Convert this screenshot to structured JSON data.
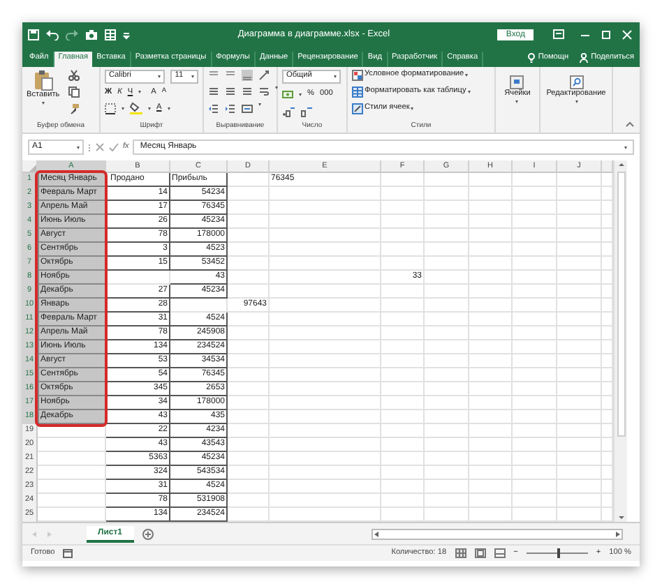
{
  "window": {
    "title": "Диаграмма в диаграмме.xlsx  -  Excel",
    "sign_in": "Вход"
  },
  "tabs": [
    {
      "label": "Файл",
      "selected": false
    },
    {
      "label": "Главная",
      "selected": true
    },
    {
      "label": "Вставка",
      "selected": false
    },
    {
      "label": "Разметка страницы",
      "selected": false
    },
    {
      "label": "Формулы",
      "selected": false
    },
    {
      "label": "Данные",
      "selected": false
    },
    {
      "label": "Рецензирование",
      "selected": false
    },
    {
      "label": "Вид",
      "selected": false
    },
    {
      "label": "Разработчик",
      "selected": false
    },
    {
      "label": "Справка",
      "selected": false
    }
  ],
  "tell_me": "Помощн",
  "share": "Поделиться",
  "ribbon": {
    "clipboard": {
      "paste": "Вставить",
      "label": "Буфер обмена"
    },
    "font": {
      "name": "Calibri",
      "size": "11",
      "bold": "Ж",
      "italic": "К",
      "underline": "Ч",
      "grow": "A",
      "shrink": "A",
      "font_color_button": "A",
      "label": "Шрифт"
    },
    "alignment": {
      "label": "Выравнивание"
    },
    "number": {
      "format": "Общий",
      "percent": "%",
      "thousands": "000",
      "label": "Число"
    },
    "styles": {
      "items": [
        "Условное форматирование",
        "Форматировать как таблицу",
        "Стили ячеек"
      ],
      "label": "Стили"
    },
    "cells": "Ячейки",
    "editing": "Редактирование"
  },
  "formula_bar": {
    "name_box": "A1",
    "function": "fx",
    "value": "Месяц Январь"
  },
  "columns": [
    "A",
    "B",
    "C",
    "D",
    "E",
    "F",
    "G",
    "H",
    "I",
    "J"
  ],
  "rows": [
    {
      "number": "1",
      "selected": true,
      "A": "Месяц Январь",
      "B": "Продано",
      "C": "Прибыль",
      "E": "76345"
    },
    {
      "number": "2",
      "selected": true,
      "A": "Февраль Март",
      "B": "14",
      "C": "54234"
    },
    {
      "number": "3",
      "selected": true,
      "A": "Апрель Май",
      "B": "17",
      "C": "76345"
    },
    {
      "number": "4",
      "selected": true,
      "A": "Июнь Июль",
      "B": "26",
      "C": "45234"
    },
    {
      "number": "5",
      "selected": true,
      "A": "Август",
      "B": "78",
      "C": "178000"
    },
    {
      "number": "6",
      "selected": true,
      "A": "Сентябрь",
      "B": "3",
      "C": "4523"
    },
    {
      "number": "7",
      "selected": true,
      "A": "Октябрь",
      "B": "15",
      "C": "53452"
    },
    {
      "number": "8",
      "selected": true,
      "A": "Ноябрь",
      "C": "43",
      "F": "33"
    },
    {
      "number": "9",
      "selected": true,
      "A": "Декабрь",
      "B": "27",
      "C": "45234"
    },
    {
      "number": "10",
      "selected": true,
      "A": "Январь",
      "B": "28",
      "D": "97643"
    },
    {
      "number": "11",
      "selected": true,
      "A": "Февраль Март",
      "B": "31",
      "C": "4524"
    },
    {
      "number": "12",
      "selected": true,
      "A": "Апрель Май",
      "B": "78",
      "C": "245908"
    },
    {
      "number": "13",
      "selected": true,
      "A": "Июнь Июль",
      "B": "134",
      "C": "234524"
    },
    {
      "number": "14",
      "selected": true,
      "A": "Август",
      "B": "53",
      "C": "34534"
    },
    {
      "number": "15",
      "selected": true,
      "A": "Сентябрь",
      "B": "54",
      "C": "76345"
    },
    {
      "number": "16",
      "selected": true,
      "A": "Октябрь",
      "B": "345",
      "C": "2653"
    },
    {
      "number": "17",
      "selected": true,
      "A": "Ноябрь",
      "B": "34",
      "C": "178000"
    },
    {
      "number": "18",
      "selected": true,
      "A": "Декабрь",
      "B": "43",
      "C": "435"
    },
    {
      "number": "19",
      "selected": false,
      "B": "22",
      "C": "4234"
    },
    {
      "number": "20",
      "selected": false,
      "B": "43",
      "C": "43543"
    },
    {
      "number": "21",
      "selected": false,
      "B": "5363",
      "C": "45234"
    },
    {
      "number": "22",
      "selected": false,
      "B": "324",
      "C": "543534"
    },
    {
      "number": "23",
      "selected": false,
      "B": "31",
      "C": "4524"
    },
    {
      "number": "24",
      "selected": false,
      "B": "78",
      "C": "531908"
    },
    {
      "number": "25",
      "selected": false,
      "B": "134",
      "C": "234524"
    }
  ],
  "sheet_tabs": [
    {
      "label": "Лист1",
      "selected": true
    }
  ],
  "status_bar": {
    "status": "Готово",
    "count": "Количество: 18",
    "zoom_out": "−",
    "zoom_in": "+",
    "zoom": "100 %",
    "zoom_level": {
      "level": 0.5
    }
  }
}
